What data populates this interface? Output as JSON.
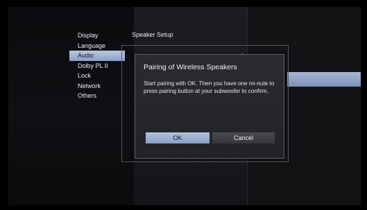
{
  "menu": {
    "items": [
      {
        "label": "Display"
      },
      {
        "label": "Language"
      },
      {
        "label": "Audio",
        "active": true
      },
      {
        "label": "Dolby PL II"
      },
      {
        "label": "Lock"
      },
      {
        "label": "Network"
      },
      {
        "label": "Others"
      }
    ]
  },
  "section": {
    "title": "Speaker Setup"
  },
  "dialog": {
    "title": "Pairing of Wireless Speakers",
    "body": "Start pairing with OK. Then you have one mi-nute to press pairing button at your subwoofer to confirm.",
    "ok_label": "OK",
    "cancel_label": "Cancel"
  },
  "colors": {
    "highlight": "#9fb1d3",
    "panel": "#1c1d21",
    "background": "#000000"
  }
}
